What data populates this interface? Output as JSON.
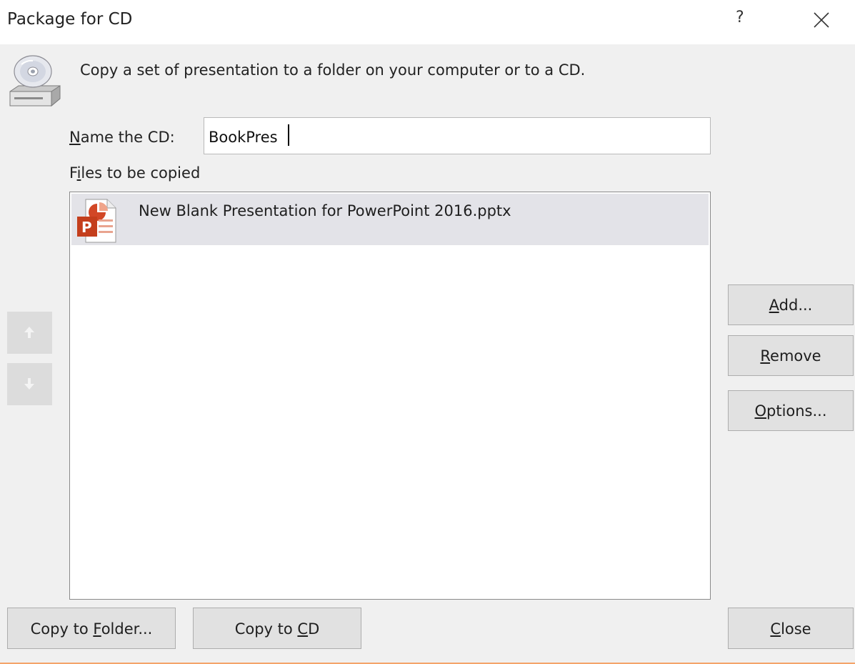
{
  "dialog": {
    "title": "Package for CD",
    "help_label": "?",
    "description": "Copy a set of presentation to a folder on your computer or to a CD."
  },
  "name_cd": {
    "label_accel": "N",
    "label_rest": "ame the CD:",
    "value": "BookPres"
  },
  "files": {
    "label_first": "F",
    "label_accel": "i",
    "label_rest": "les to be copied",
    "items": [
      {
        "name": "New Blank Presentation for PowerPoint 2016.pptx",
        "icon": "powerpoint-file-icon",
        "selected": true
      }
    ]
  },
  "buttons": {
    "add": {
      "accel": "A",
      "rest": "dd..."
    },
    "remove": {
      "accel": "R",
      "rest": "emove"
    },
    "options": {
      "accel": "O",
      "rest": "ptions..."
    },
    "copy_folder": {
      "pre": "Copy to ",
      "accel": "F",
      "rest": "older..."
    },
    "copy_cd": {
      "pre": "Copy to ",
      "accel": "C",
      "rest": "D"
    },
    "close": {
      "accel": "C",
      "rest": "lose"
    }
  },
  "colors": {
    "dialog_bg": "#f0f0f0",
    "selection": "#e3e3e8",
    "button_bg": "#e1e1e1",
    "accent_line": "#f4a46a"
  },
  "icons": {
    "cd": "cd-drive-icon",
    "move_up": "arrow-up-icon",
    "move_down": "arrow-down-icon",
    "close": "close-icon"
  }
}
